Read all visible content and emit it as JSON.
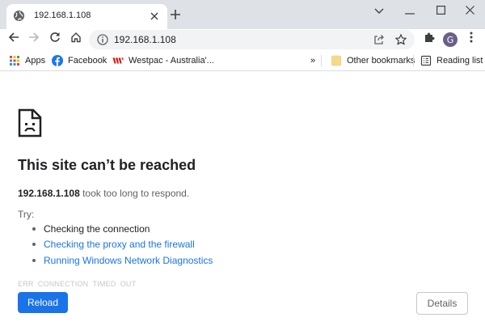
{
  "tab": {
    "title": "192.168.1.108",
    "favicon": "globe-icon"
  },
  "window_controls": [
    "chevron-down-icon",
    "minimize-icon",
    "maximize-icon",
    "close-icon"
  ],
  "toolbar": {
    "back": "arrow-left-icon",
    "forward": "arrow-right-icon",
    "reload": "reload-icon",
    "home": "home-icon",
    "url": "192.168.1.108",
    "profile_initial": "G",
    "accent": "#1a73e8"
  },
  "bookmarks": {
    "items": [
      {
        "label": "Apps",
        "icon": "apps-grid-icon"
      },
      {
        "label": "Facebook",
        "icon": "facebook-icon"
      },
      {
        "label": "Westpac - Australia'...",
        "icon": "westpac-icon"
      }
    ],
    "overflow": "»",
    "other": "Other bookmarks",
    "reading_list": "Reading list"
  },
  "error": {
    "title": "This site can’t be reached",
    "host": "192.168.1.108",
    "message": " took too long to respond.",
    "try_label": "Try:",
    "suggestions": [
      {
        "text": "Checking the connection",
        "link": false
      },
      {
        "text": "Checking the proxy and the firewall",
        "link": true
      },
      {
        "text": "Running Windows Network Diagnostics",
        "link": true
      }
    ],
    "code": "ERR_CONNECTION_TIMED_OUT",
    "reload_label": "Reload",
    "details_label": "Details"
  }
}
